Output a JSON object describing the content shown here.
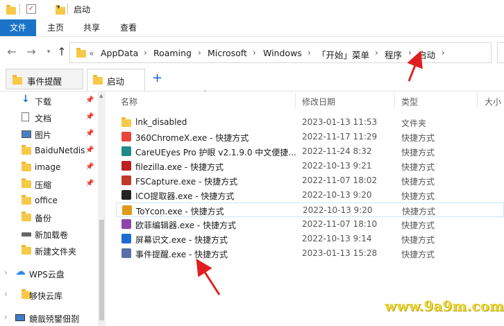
{
  "titlebar": {
    "title": "启动"
  },
  "ribbon": {
    "tabs": [
      "文件",
      "主页",
      "共享",
      "查看"
    ]
  },
  "address": {
    "overflow": "«",
    "crumbs": [
      "AppData",
      "Roaming",
      "Microsoft",
      "Windows",
      "「开始」菜单",
      "程序",
      "启动"
    ]
  },
  "tabs": [
    {
      "label": "事件提醒"
    },
    {
      "label": "启动"
    }
  ],
  "sidebar": {
    "items": [
      {
        "label": "下载",
        "icon": "download-icon",
        "pinned": true
      },
      {
        "label": "文档",
        "icon": "document-icon",
        "pinned": true
      },
      {
        "label": "图片",
        "icon": "picture-icon",
        "pinned": true
      },
      {
        "label": "BaiduNetdis",
        "icon": "folder-icon",
        "pinned": true
      },
      {
        "label": "image",
        "icon": "folder-icon",
        "pinned": true
      },
      {
        "label": "压缩",
        "icon": "folder-icon",
        "pinned": true
      },
      {
        "label": "office",
        "icon": "folder-icon",
        "pinned": false
      },
      {
        "label": "备份",
        "icon": "folder-icon",
        "pinned": false
      },
      {
        "label": "新加载卷",
        "icon": "drive-icon",
        "pinned": false
      },
      {
        "label": "新建文件夹",
        "icon": "folder-icon",
        "pinned": false
      },
      {
        "label": "WPS云盘",
        "icon": "cloud-icon",
        "pinned": false
      },
      {
        "label": "够快云库",
        "icon": "folder-icon",
        "pinned": false
      },
      {
        "label": "鏡戠殑鐢佃剳",
        "icon": "computer-icon",
        "pinned": false
      }
    ]
  },
  "columns": {
    "name": "名称",
    "date": "修改日期",
    "type": "类型",
    "size": "大小"
  },
  "files": [
    {
      "name": "lnk_disabled",
      "date": "2023-01-13 11:53",
      "type": "文件夹",
      "icon": "folder-icon",
      "color": "#f7c948"
    },
    {
      "name": "360ChromeX.exe - 快捷方式",
      "date": "2022-11-17 11:29",
      "type": "快捷方式",
      "icon": "chrome-icon",
      "color": "#e8453c"
    },
    {
      "name": "CareUEyes Pro 护眼 v2.1.9.0 中文便捷...",
      "date": "2022-11-24 8:32",
      "type": "快捷方式",
      "icon": "eye-icon",
      "color": "#1e8a8a"
    },
    {
      "name": "filezilla.exe - 快捷方式",
      "date": "2022-10-13 9:21",
      "type": "快捷方式",
      "icon": "filezilla-icon",
      "color": "#bf1e1e"
    },
    {
      "name": "FSCapture.exe - 快捷方式",
      "date": "2022-11-07 18:02",
      "type": "快捷方式",
      "icon": "capture-icon",
      "color": "#c0392b"
    },
    {
      "name": "ICO提取器.exe - 快捷方式",
      "date": "2022-10-13 9:20",
      "type": "快捷方式",
      "icon": "ico-extractor-icon",
      "color": "#222222"
    },
    {
      "name": "ToYcon.exe - 快捷方式",
      "date": "2022-10-13 9:20",
      "type": "快捷方式",
      "icon": "toycon-icon",
      "color": "#e09a1a"
    },
    {
      "name": "欧菲编辑器.exe - 快捷方式",
      "date": "2022-11-07 18:10",
      "type": "快捷方式",
      "icon": "editor-icon",
      "color": "#8e44ad"
    },
    {
      "name": "屏幕识文.exe - 快捷方式",
      "date": "2022-10-13 9:14",
      "type": "快捷方式",
      "icon": "ocr-icon",
      "color": "#1e6bd6"
    },
    {
      "name": "事件提醒.exe - 快捷方式",
      "date": "2023-01-13 15:28",
      "type": "快捷方式",
      "icon": "reminder-icon",
      "color": "#5a6fa8"
    }
  ],
  "selected_row": 6,
  "watermark": "www.9a9m.com"
}
